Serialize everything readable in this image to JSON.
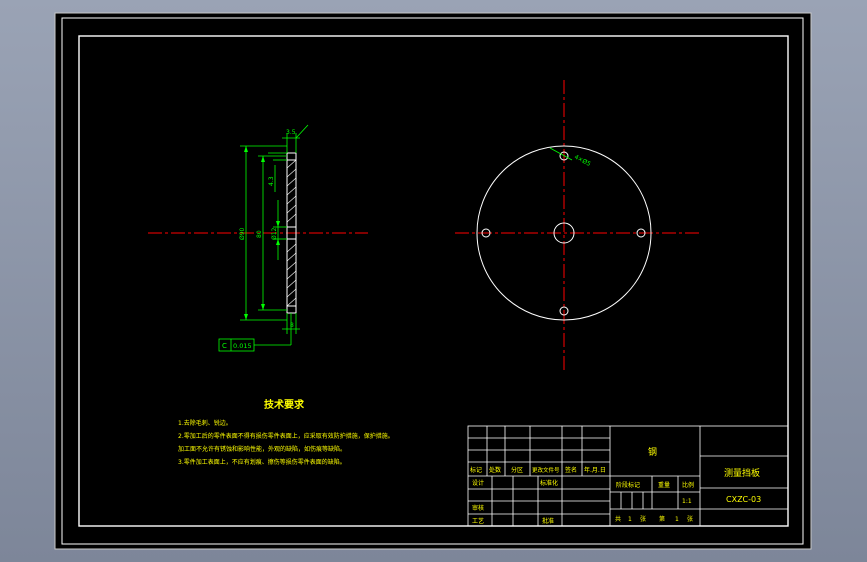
{
  "colors": {
    "background": "#000000",
    "frame": "#ffffff",
    "dimension": "#00ff00",
    "centerline": "#ff0000",
    "hatch": "#ffffff",
    "tech_text": "#ffff00",
    "title_text": "#ffff00",
    "outer_bg": "#8b93a6"
  },
  "side_view": {
    "dim_top": "3.5",
    "dim_bottom": "8",
    "dim_small_height": "4.3",
    "dim_outer_diameter": "Ø90",
    "dim_bolt_circle": "80",
    "dim_center_hole": "Ø12",
    "flatness_symbol": "C",
    "flatness_tolerance": "0.015"
  },
  "front_view": {
    "hole_label": "4×Ø5"
  },
  "tech_requirements": {
    "title": "技术要求",
    "lines": [
      "1.去除毛刺、锐边。",
      "2.零加工后的零件表面不得有损伤零件表面上，应采取有效防护措施，保护措施。",
      "加工面不允许有锈蚀和影响性能，外观的缺陷，如伤痕等缺陷。",
      "3.零件加工表面上，不应有划痕、擦伤等损伤零件表面的缺陷。"
    ]
  },
  "title_block": {
    "material": "钢",
    "part_name": "测量挡板",
    "drawing_number": "CXZC-03",
    "scale": "1:1",
    "label_mark": "标记",
    "label_count": "处数",
    "label_zone": "分区",
    "label_change_doc": "更改文件号",
    "label_sign": "签名",
    "label_date": "年.月.日",
    "label_design": "设计",
    "label_standard": "标准化",
    "label_review": "审核",
    "label_process": "工艺",
    "label_approve": "批准",
    "label_stage": "阶段标记",
    "label_weight": "重量",
    "label_scale": "比例",
    "label_total": "共",
    "label_sheets": "张",
    "label_sheet_no": "第",
    "sheets_total": "1",
    "sheet_no": "1"
  }
}
